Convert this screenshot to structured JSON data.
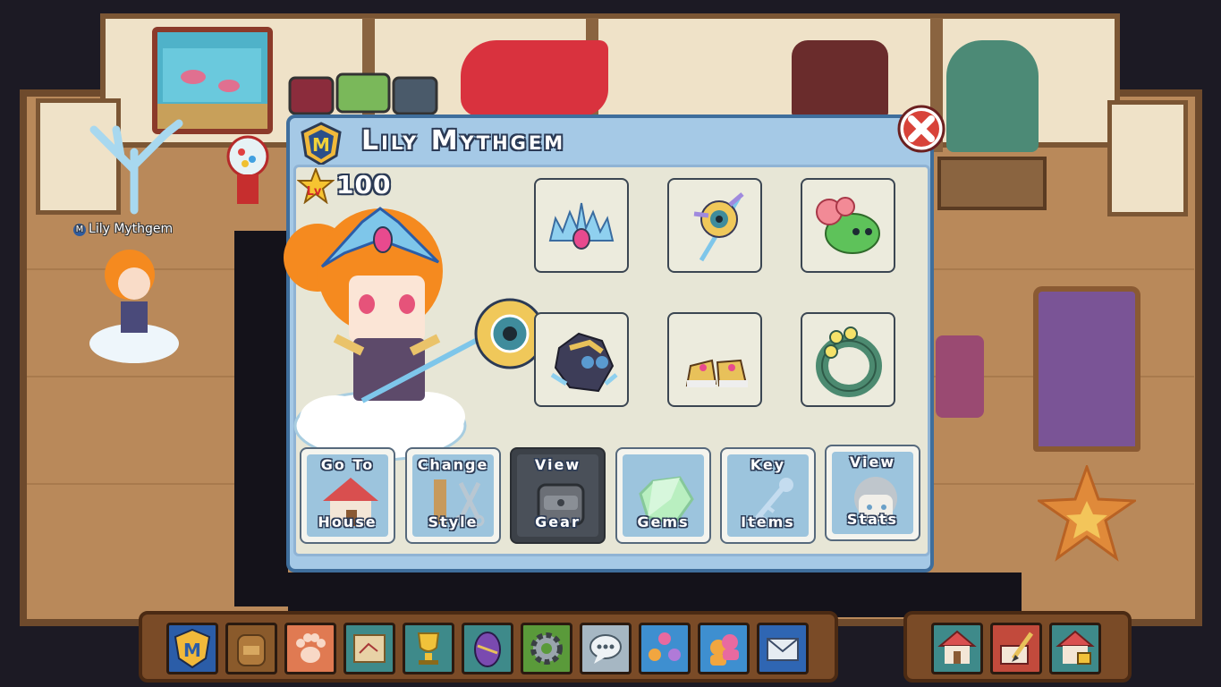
{
  "player": {
    "name": "Lily Mythgem",
    "world_name_tag": "Lily Mythgem",
    "member_badge": "M",
    "level_prefix": "Lv",
    "level": "100"
  },
  "equipment": [
    {
      "slot": "hat",
      "icon": "crystal-crown-icon"
    },
    {
      "slot": "weapon",
      "icon": "eye-staff-icon"
    },
    {
      "slot": "pet",
      "icon": "green-flower-pet-icon"
    },
    {
      "slot": "outfit",
      "icon": "armored-outfit-icon"
    },
    {
      "slot": "boots",
      "icon": "gem-boots-icon"
    },
    {
      "slot": "relic",
      "icon": "jade-ring-icon"
    }
  ],
  "actions": [
    {
      "line1": "Go To",
      "line2": "House",
      "icon": "house-icon",
      "active": false
    },
    {
      "line1": "Change",
      "line2": "Style",
      "icon": "comb-scissors-icon",
      "active": false
    },
    {
      "line1": "View",
      "line2": "Gear",
      "icon": "backpack-icon",
      "active": true
    },
    {
      "line1": "",
      "line2": "Gems",
      "icon": "gem-icon",
      "active": false
    },
    {
      "line1": "Key",
      "line2": "Items",
      "icon": "key-staff-icon",
      "active": false
    },
    {
      "line1": "View",
      "line2": "Stats",
      "icon": "character-head-icon",
      "active": false
    }
  ],
  "hotbar": [
    {
      "icon": "member-m-icon",
      "color": "#2b5da8"
    },
    {
      "icon": "backpack-icon",
      "color": "#8a5a2b"
    },
    {
      "icon": "paw-icon",
      "color": "#e07a52"
    },
    {
      "icon": "map-icon",
      "color": "#3e8a8a"
    },
    {
      "icon": "trophy-icon",
      "color": "#3e8a8a"
    },
    {
      "icon": "egg-icon",
      "color": "#3e8a8a"
    },
    {
      "icon": "settings-gear-icon",
      "color": "#5a9a3a"
    },
    {
      "icon": "chat-bubble-icon",
      "color": "#a6b7c3"
    },
    {
      "icon": "friends-icon",
      "color": "#3e8fd0"
    },
    {
      "icon": "social-icon",
      "color": "#3e8fd0"
    },
    {
      "icon": "mail-icon",
      "color": "#2f66b3"
    }
  ],
  "hotbar_right": [
    {
      "icon": "house-icon",
      "color": "#3e8a8a"
    },
    {
      "icon": "house-edit-icon",
      "color": "#c24a3c"
    },
    {
      "icon": "house-lock-icon",
      "color": "#3e8a8a"
    }
  ]
}
